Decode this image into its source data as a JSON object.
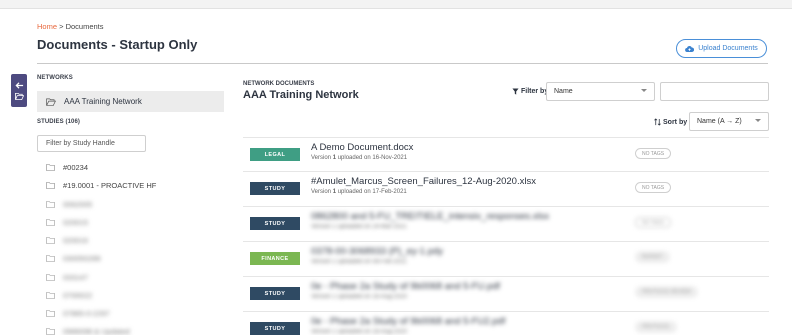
{
  "breadcrumb": {
    "home": "Home",
    "separator": " > ",
    "current": "Documents"
  },
  "page_title": "Documents - Startup Only",
  "upload_button": {
    "label": "Upload Documents",
    "icon": "cloud-upload-icon"
  },
  "side_tab": {
    "icons": [
      "arrow-left-icon",
      "folder-open-icon"
    ],
    "color": "#4d4a80"
  },
  "networks": {
    "label": "NETWORKS",
    "items": [
      {
        "label": "AAA Training Network",
        "icon": "folder-open-icon"
      }
    ]
  },
  "studies": {
    "label": "STUDIES (106)",
    "filter_placeholder": "Filter by Study Handle",
    "items": [
      {
        "label": "#00234"
      },
      {
        "label": "#19.0001 - PROACTIVE HF"
      },
      {
        "label": "0062005"
      },
      {
        "label": "020015"
      },
      {
        "label": "020016"
      },
      {
        "label": "030050289"
      },
      {
        "label": "033147"
      },
      {
        "label": "0700022"
      },
      {
        "label": "07865-0-2297"
      },
      {
        "label": "0986098 & Updated"
      }
    ]
  },
  "network_documents": {
    "label": "NETWORK DOCUMENTS",
    "title": "AAA Training Network"
  },
  "filter": {
    "label": "Filter by",
    "icon": "filter-funnel-icon",
    "selected": "Name",
    "search_value": ""
  },
  "sort": {
    "label": "Sort by",
    "icon": "sort-arrows-icon",
    "selected": "Name (A → Z)"
  },
  "colors": {
    "accent": "#e8683d",
    "study": "#2f4a63",
    "legal": "#3f9e84",
    "finance": "#7bb752",
    "upload": "#3b82cf"
  },
  "documents": [
    {
      "category": "LEGAL",
      "name": "A Demo Document.docx",
      "version_prefix": "Version ",
      "version": "1",
      "uploaded_text": " uploaded on ",
      "date": "16-Nov-2021",
      "tag": "NO TAGS"
    },
    {
      "category": "STUDY",
      "name": "#Amulet_Marcus_Screen_Failures_12-Aug-2020.xlsx",
      "version_prefix": "Version ",
      "version": "1",
      "uploaded_text": " uploaded on ",
      "date": "17-Feb-2021",
      "tag": "NO TAGS"
    },
    {
      "category": "STUDY",
      "name": "0862800 and 5-FU_TREITIELE_intensiv_responses.xlsx",
      "meta": "Version 1 uploaded on 24-Mar-2021",
      "tag": "NO TAGS"
    },
    {
      "category": "FINANCE",
      "name": "0378-00-3068933 (P)_ey-1.pdy",
      "meta": "Version 1 uploaded on 08-Feb-2021",
      "tag": "BUDGET"
    },
    {
      "category": "STUDY",
      "name": "0e - Phase 2a Study of 9b0068 and 5-FU.pdf",
      "meta": "Version 1 uploaded on 16-Aug-2020",
      "tag": "PROTOCOL REVIEW"
    },
    {
      "category": "STUDY",
      "name": "0e - Phase 2a Study of 9b0068 and 5-FU2.pdf",
      "meta": "Version 1 uploaded on 18-Aug-2020",
      "tag": "PROTOCOL"
    }
  ]
}
